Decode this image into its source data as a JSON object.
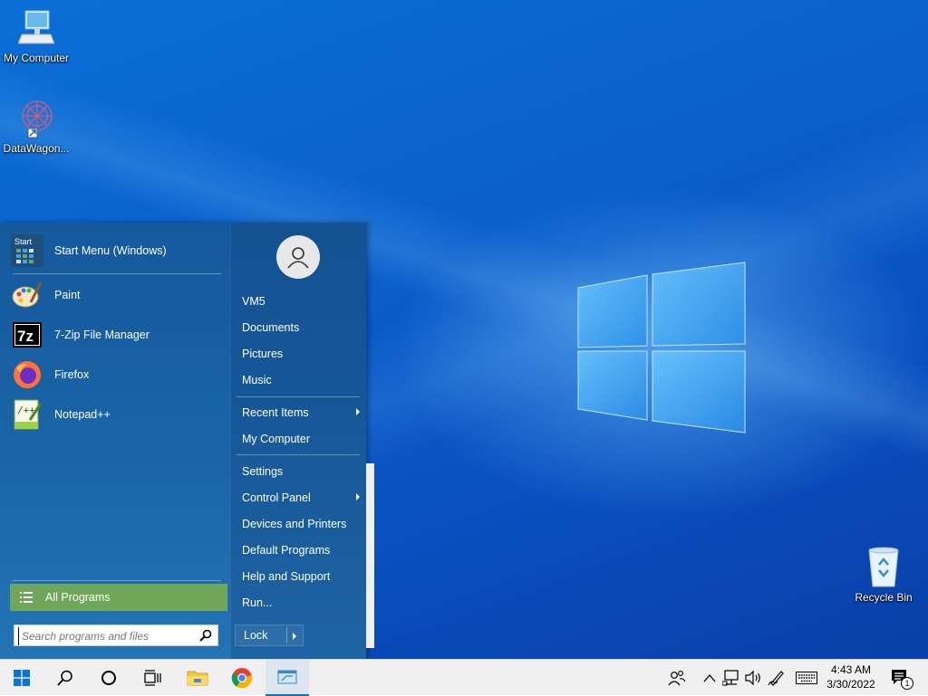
{
  "desktop": {
    "icons": [
      {
        "label": "My Computer",
        "icon": "computer-icon"
      },
      {
        "label": "DataWagon...",
        "icon": "datawagon-icon"
      },
      {
        "label": "Recycle Bin",
        "icon": "recycle-bin-icon"
      }
    ]
  },
  "start_menu": {
    "pinned": [
      {
        "label": "Start Menu (Windows)",
        "icon": "start-menu-icon"
      }
    ],
    "recent": [
      {
        "label": "Paint",
        "icon": "paint-icon"
      },
      {
        "label": "7-Zip File Manager",
        "icon": "7zip-icon"
      },
      {
        "label": "Firefox",
        "icon": "firefox-icon"
      },
      {
        "label": "Notepad++",
        "icon": "notepadpp-icon"
      }
    ],
    "all_programs_label": "All Programs",
    "search_placeholder": "Search programs and files",
    "right": {
      "user": "VM5",
      "documents": "Documents",
      "pictures": "Pictures",
      "music": "Music",
      "recent_items": "Recent Items",
      "my_computer": "My Computer",
      "settings": "Settings",
      "control_panel": "Control Panel",
      "devices_printers": "Devices and Printers",
      "default_programs": "Default Programs",
      "help_support": "Help and Support",
      "run": "Run..."
    },
    "lock_label": "Lock"
  },
  "taskbar": {
    "clock_time": "4:43 AM",
    "clock_date": "3/30/2022",
    "notification_count": "1"
  },
  "colors": {
    "desktop_blue": "#0b5fcc",
    "menu_blue": "#1a64a6",
    "all_programs_green": "#6fa65a",
    "taskbar": "#f0f0f0"
  }
}
